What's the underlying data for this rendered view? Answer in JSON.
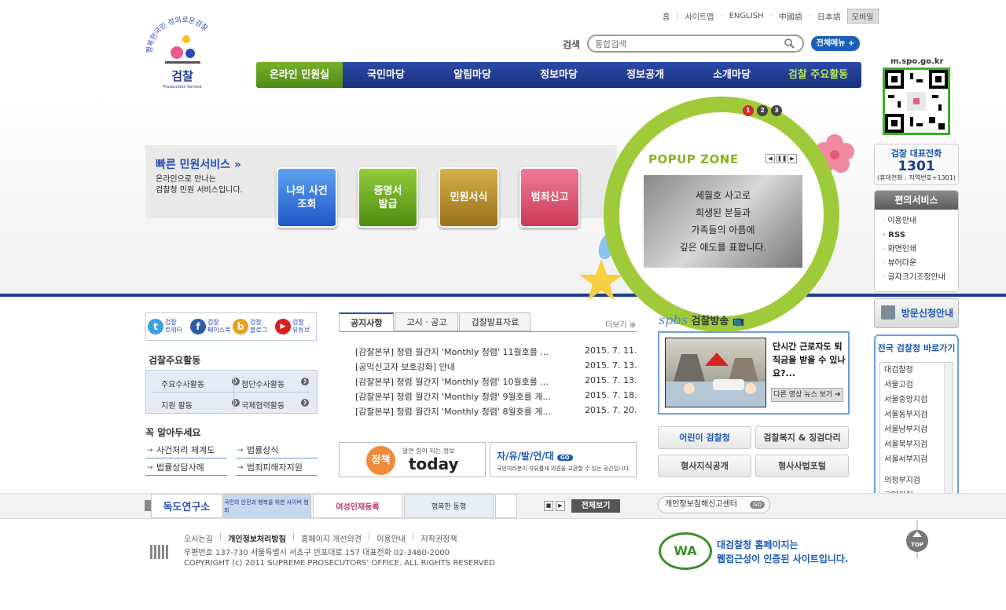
{
  "logo": {
    "slogan": "행복한국민 정의로운검찰",
    "name": "검찰",
    "sub": "Prosecution Service"
  },
  "toplinks": [
    "홈",
    "사이트맵",
    "ENGLISH",
    "中國語",
    "日本語"
  ],
  "mobile": "모바일",
  "search": {
    "label": "검색",
    "placeholder": "통합검색"
  },
  "allmenu": "전체메뉴",
  "gnb": [
    "온라인 민원실",
    "국민마당",
    "알림마당",
    "정보마당",
    "정보공개",
    "소개마당",
    "검찰 주요활동"
  ],
  "qr_label": "m.spo.go.kr",
  "call": {
    "title": "검찰 대표전화",
    "number": "1301",
    "note": "(휴대전화 : 지역번호+1301)"
  },
  "convenience": {
    "title": "편의서비스",
    "items": [
      "이용안내",
      "RSS",
      "화면인쇄",
      "뷰어다운",
      "글자크기조정안내"
    ]
  },
  "visit": "방문신청안내",
  "sites": {
    "title": "전국 검찰청 바로가기",
    "items": [
      "대검찰청",
      "서울고검",
      "서울중앙지검",
      "서울동부지검",
      "서울남부지검",
      "서울북부지검",
      "서울서부지검",
      "의정부지검",
      "고양지청"
    ]
  },
  "quick": {
    "title": "빠른 민원서비스",
    "desc1": "온라인으로 만나는",
    "desc2": "검찰청 민원 서비스입니다.",
    "buttons": [
      "나의 사건\n조회",
      "증명서\n발급",
      "민원서식",
      "범죄신고"
    ]
  },
  "popup": {
    "title": "POPUP ZONE",
    "pages": [
      "1",
      "2",
      "3"
    ],
    "lines": [
      "세월호 사고로",
      "희생된 분들과",
      "가족들의 아픔에",
      "깊은 애도를 표합니다."
    ]
  },
  "sns": [
    {
      "l1": "검찰",
      "l2": "트위터",
      "icon": "t",
      "color": "#3aa0e0"
    },
    {
      "l1": "검찰",
      "l2": "페이스북",
      "icon": "f",
      "color": "#2d5ca8"
    },
    {
      "l1": "검찰",
      "l2": "블로그",
      "icon": "b",
      "color": "#e9a21a"
    },
    {
      "l1": "검찰",
      "l2": "유튜브",
      "icon": "▶",
      "color": "#d42020"
    }
  ],
  "activities": {
    "title": "검찰주요활동",
    "items": [
      "주요수사활동",
      "첨단수사활동",
      "지원 활동",
      "국제협력활동"
    ]
  },
  "know": {
    "title": "꼭 알아두세요",
    "items": [
      "사건처리 체계도",
      "법률상식",
      "법률상담사례",
      "범죄피해자지원"
    ]
  },
  "tabs": [
    "공지사항",
    "고시 · 공고",
    "검찰발표자료"
  ],
  "more": "더보기",
  "notices": [
    {
      "title": "[감찰본부] 청렴 월간지 'Monthly 청렴' 11월호를 ...",
      "date": "2015. 7. 11."
    },
    {
      "title": "[공익신고자 보호강화] 안내",
      "date": "2015. 7. 13."
    },
    {
      "title": "[감찰본부] 청렴 월간지 'Monthly 청렴' 10월호를 ...",
      "date": "2015. 7. 13."
    },
    {
      "title": "[감찰본부] 청렴 월간지 'Monthly 청렴' 9월호를 게...",
      "date": "2015. 7. 18."
    },
    {
      "title": "[감찰본부] 청렴 월간지 'Monthly 청렴' 8월호를 게...",
      "date": "2015. 7. 20."
    }
  ],
  "policy_banner": {
    "badge": "정책",
    "sub": "알면 힘이 되는 정보",
    "main": "today"
  },
  "free_banner": {
    "title": "자/유/발/언/대",
    "go": "GO",
    "desc": "국민여러분이 자유롭게 의견을 교환할 수 있는 공간입니다."
  },
  "spbs": {
    "logo": "spbs",
    "title": "검찰방송",
    "text": "단시간 근로자도 퇴직금을 받을 수 있나요?...",
    "more": "다른 영상 뉴스 보기"
  },
  "right_buttons": [
    "어린이 검찰청",
    "검찰복지 & 징검다리",
    "형사지식공개",
    "형사사법포털"
  ],
  "strip": {
    "banners": [
      "독도연구소",
      "국민의 안전과 행복을 위한 사이버 범죄",
      "여성인재등록",
      "행복한 동행"
    ],
    "all": "전체보기",
    "privacy": "개인정보침해신고센터",
    "go": "GO"
  },
  "footer": {
    "links": [
      "오시는길",
      "개인정보처리방침",
      "홈페이지 개선의견",
      "이용안내",
      "저작권정책"
    ],
    "address": "우편번호 137-730 서울특별시 서초구 반포대로 157 대표전화 02-3480-2000",
    "copyright": "COPYRIGHT (c) 2011 SUPREME PROSECUTORS' OFFICE. ALL RIGHTS RESERVED",
    "wa": "WA",
    "wa_text1": "대검찰청 홈페이지는",
    "wa_text2": "웹접근성이 인증된 사이트입니다.",
    "top": "TOP"
  }
}
